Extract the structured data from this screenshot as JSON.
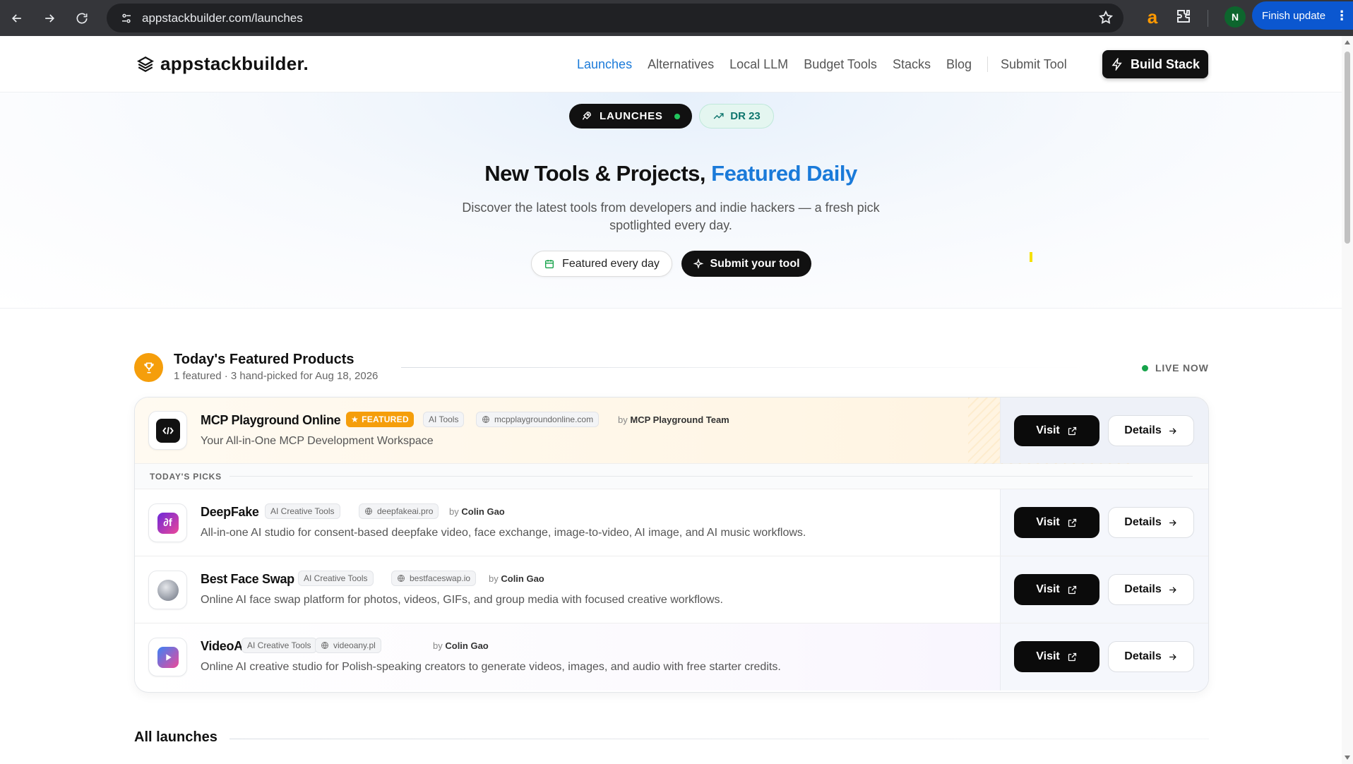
{
  "browser": {
    "url": "appstackbuilder.com/launches",
    "profile_initial": "N",
    "update_label": "Finish update",
    "amazon_ext": "a"
  },
  "site": {
    "logo_text": "appstackbuilder.",
    "nav": [
      {
        "label": "Launches",
        "active": true
      },
      {
        "label": "Alternatives"
      },
      {
        "label": "Local LLM"
      },
      {
        "label": "Budget Tools"
      },
      {
        "label": "Stacks"
      },
      {
        "label": "Blog"
      },
      {
        "label": "Submit Tool"
      }
    ],
    "build_button": "Build Stack"
  },
  "hero": {
    "pill_launches": "LAUNCHES",
    "pill_dr": "DR 23",
    "title_main": "New Tools & Projects,",
    "title_accent": "Featured Daily",
    "subtitle": "Discover the latest tools from developers and indie hackers — a fresh pick spotlighted every day.",
    "featured_button": "Featured every day",
    "submit_button": "Submit your tool"
  },
  "featured_section": {
    "title": "Today's Featured Products",
    "meta": "1 featured · 3 hand-picked for Aug 18, 2026",
    "live_label": "LIVE NOW",
    "picks_label": "TODAY'S PICKS",
    "featured_product": {
      "name": "MCP Playground Online",
      "badge": "FEATURED",
      "category": "AI Tools",
      "domain": "mcpplaygroundonline.com",
      "by_prefix": "by",
      "author": "MCP Playground Team",
      "description": "Your All-in-One MCP Development Workspace"
    },
    "picks": [
      {
        "name": "DeepFake",
        "category": "AI Creative Tools",
        "domain": "deepfakeai.pro",
        "by_prefix": "by",
        "author": "Colin Gao",
        "description": "All-in-one AI studio for consent-based deepfake video, face exchange, image-to-video, AI image, and AI music workflows."
      },
      {
        "name": "Best Face Swap",
        "category": "AI Creative Tools",
        "domain": "bestfaceswap.io",
        "by_prefix": "by",
        "author": "Colin Gao",
        "description": "Online AI face swap platform for photos, videos, GIFs, and group media with focused creative workflows."
      },
      {
        "name": "VideoAny",
        "category": "AI Creative Tools",
        "domain": "videoany.pl",
        "by_prefix": "by",
        "author": "Colin Gao",
        "description": "Online AI creative studio for Polish-speaking creators to generate videos, images, and audio with free starter credits."
      }
    ],
    "visit_label": "Visit",
    "details_label": "Details"
  },
  "all_launches": {
    "title": "All launches"
  },
  "colors": {
    "accent": "#1a7ad9",
    "featured_badge": "#f59e0b",
    "live_dot": "#16a34a",
    "dark_button": "#0b0b0b"
  }
}
